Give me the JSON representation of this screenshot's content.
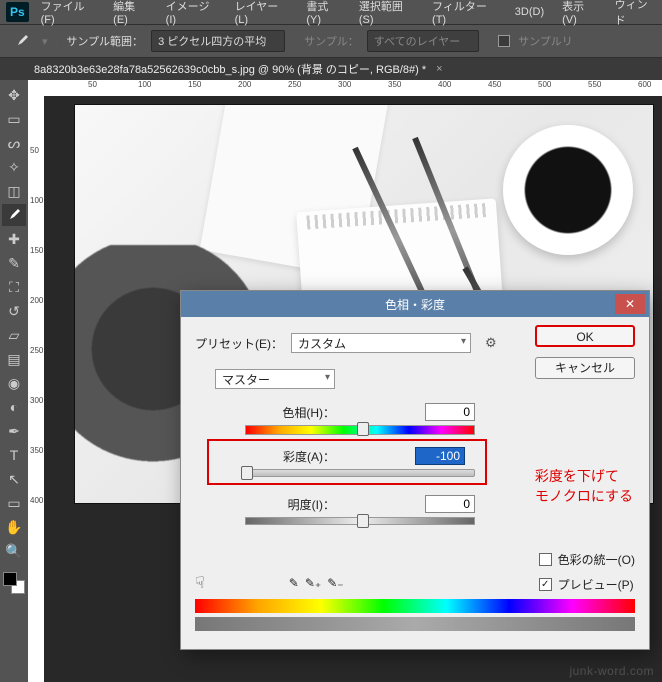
{
  "app": {
    "logo": "Ps"
  },
  "menu": {
    "file": "ファイル(F)",
    "edit": "編集(E)",
    "image": "イメージ(I)",
    "layer": "レイヤー(L)",
    "type": "書式(Y)",
    "select": "選択範囲(S)",
    "filter": "フィルター(T)",
    "threed": "3D(D)",
    "view": "表示(V)",
    "window": "ウィンド"
  },
  "options": {
    "sample_size_label": "サンプル範囲：",
    "sample_size_value": "3 ピクセル四方の平均",
    "sample_label": "サンプル：",
    "sample_value": "すべてのレイヤー",
    "sample_ring": "サンプルリ"
  },
  "document": {
    "tab_title": "8a8320b3e63e28fa78a52562639c0cbb_s.jpg @ 90% (背景 のコピー, RGB/8#) *"
  },
  "ruler": {
    "h": [
      "50",
      "100",
      "150",
      "200",
      "250",
      "300",
      "350",
      "400",
      "450",
      "500",
      "550",
      "600"
    ],
    "v": [
      "50",
      "100",
      "150",
      "200",
      "250",
      "300",
      "350",
      "400"
    ]
  },
  "dialog": {
    "title": "色相・彩度",
    "preset_label": "プリセット(E)：",
    "preset_value": "カスタム",
    "master": "マスター",
    "hue_label": "色相(H)：",
    "hue_value": "0",
    "sat_label": "彩度(A)：",
    "sat_value": "-100",
    "light_label": "明度(I)：",
    "light_value": "0",
    "ok": "OK",
    "cancel": "キャンセル",
    "colorize": "色彩の統一(O)",
    "preview": "プレビュー(P)",
    "callout_l1": "彩度を下げて",
    "callout_l2": "モノクロにする"
  },
  "watermark": "junk-word.com"
}
